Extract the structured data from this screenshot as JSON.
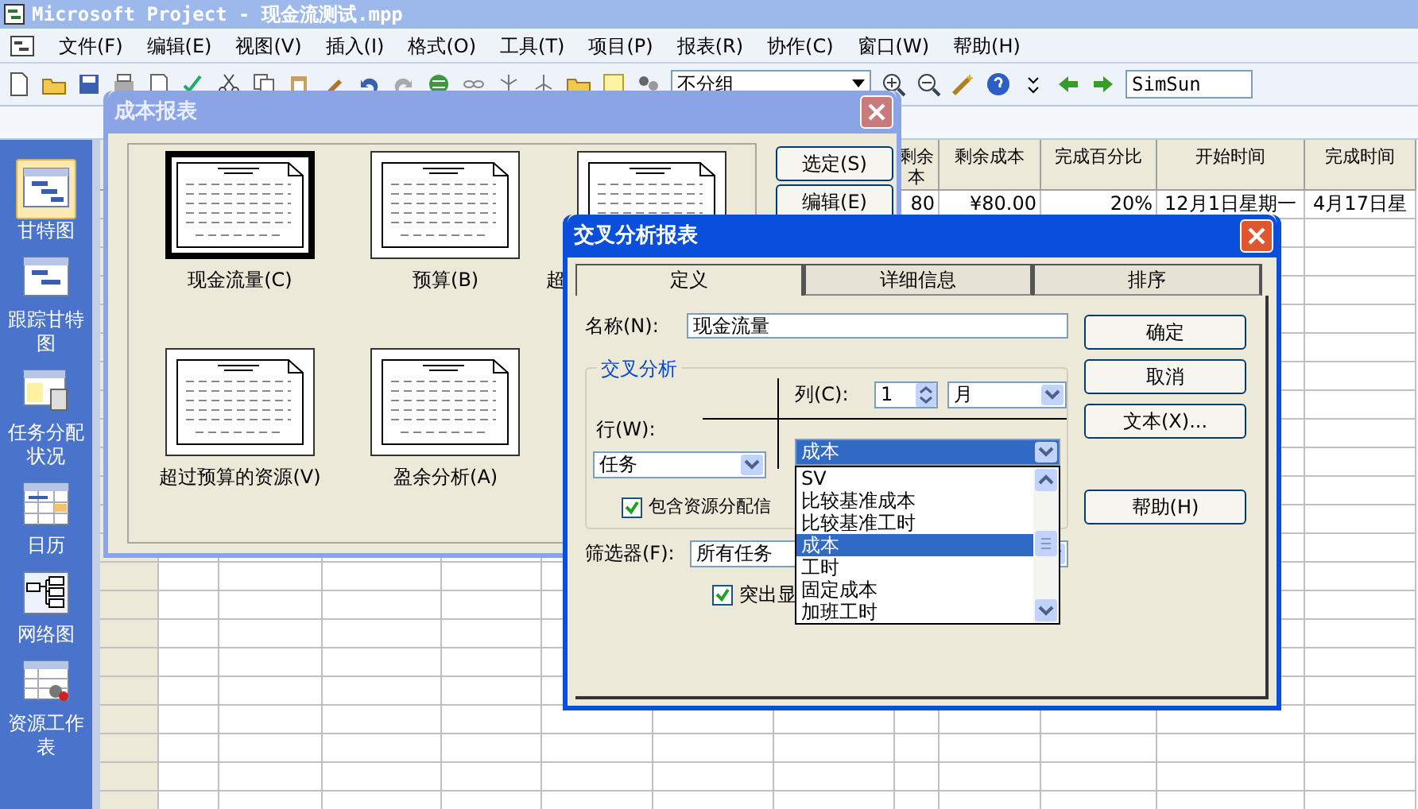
{
  "app": {
    "title": "Microsoft Project - 现金流测试.mpp",
    "menu": [
      "文件(F)",
      "编辑(E)",
      "视图(V)",
      "插入(I)",
      "格式(O)",
      "工具(T)",
      "项目(P)",
      "报表(R)",
      "协作(C)",
      "窗口(W)",
      "帮助(H)"
    ],
    "toolbar": {
      "grouping": "不分组",
      "font": "SimSun"
    }
  },
  "view_bar": [
    {
      "label": "甘特图",
      "selected": true
    },
    {
      "label": "跟踪甘特图",
      "selected": false
    },
    {
      "label": "任务分配状况",
      "selected": false
    },
    {
      "label": "日历",
      "selected": false
    },
    {
      "label": "网络图",
      "selected": false
    },
    {
      "label": "资源工作表",
      "selected": false
    }
  ],
  "table": {
    "columns": [
      {
        "lines": [
          "剩余",
          "本"
        ]
      },
      {
        "lines": [
          "剩余成本"
        ]
      },
      {
        "lines": [
          "完成百分比"
        ]
      },
      {
        "lines": [
          "开始时间"
        ]
      },
      {
        "lines": [
          "完成时间"
        ]
      }
    ],
    "rows": [
      [
        "80",
        "¥80.00",
        "20%",
        "12月1日星期一",
        "4月17日星"
      ]
    ]
  },
  "cost_reports": {
    "title": "成本报表",
    "reports": [
      {
        "label": "现金流量(C)",
        "selected": true
      },
      {
        "label": "预算(B)",
        "selected": false
      },
      {
        "label": "超",
        "selected": false
      },
      {
        "label": "超过预算的资源(V)",
        "selected": false
      },
      {
        "label": "盈余分析(A)",
        "selected": false
      }
    ],
    "buttons": [
      "选定(S)",
      "编辑(E)"
    ]
  },
  "crosstab": {
    "title": "交叉分析报表",
    "tabs": [
      {
        "label": "定义",
        "selected": true
      },
      {
        "label": "详细信息",
        "selected": false
      },
      {
        "label": "排序",
        "selected": false
      }
    ],
    "name_label": "名称(N):",
    "name_value": "现金流量",
    "group_title": "交叉分析",
    "column_label": "列(C):",
    "column_count": "1",
    "column_unit": "月",
    "row_label": "行(W):",
    "row_value": "任务",
    "field_value": "成本",
    "field_options": [
      {
        "label": "SV",
        "selected": false
      },
      {
        "label": "比较基准成本",
        "selected": false
      },
      {
        "label": "比较基准工时",
        "selected": false
      },
      {
        "label": "成本",
        "selected": true
      },
      {
        "label": "工时",
        "selected": false
      },
      {
        "label": "固定成本",
        "selected": false
      },
      {
        "label": "加班工时",
        "selected": false
      }
    ],
    "include_assignments": {
      "label": "包含资源分配信",
      "checked": true
    },
    "filter_label": "筛选器(F):",
    "filter_value": "所有任务",
    "highlight": {
      "label": "突出显",
      "checked": true
    },
    "buttons": [
      "确定",
      "取消",
      "文本(X)...",
      "帮助(H)"
    ]
  }
}
